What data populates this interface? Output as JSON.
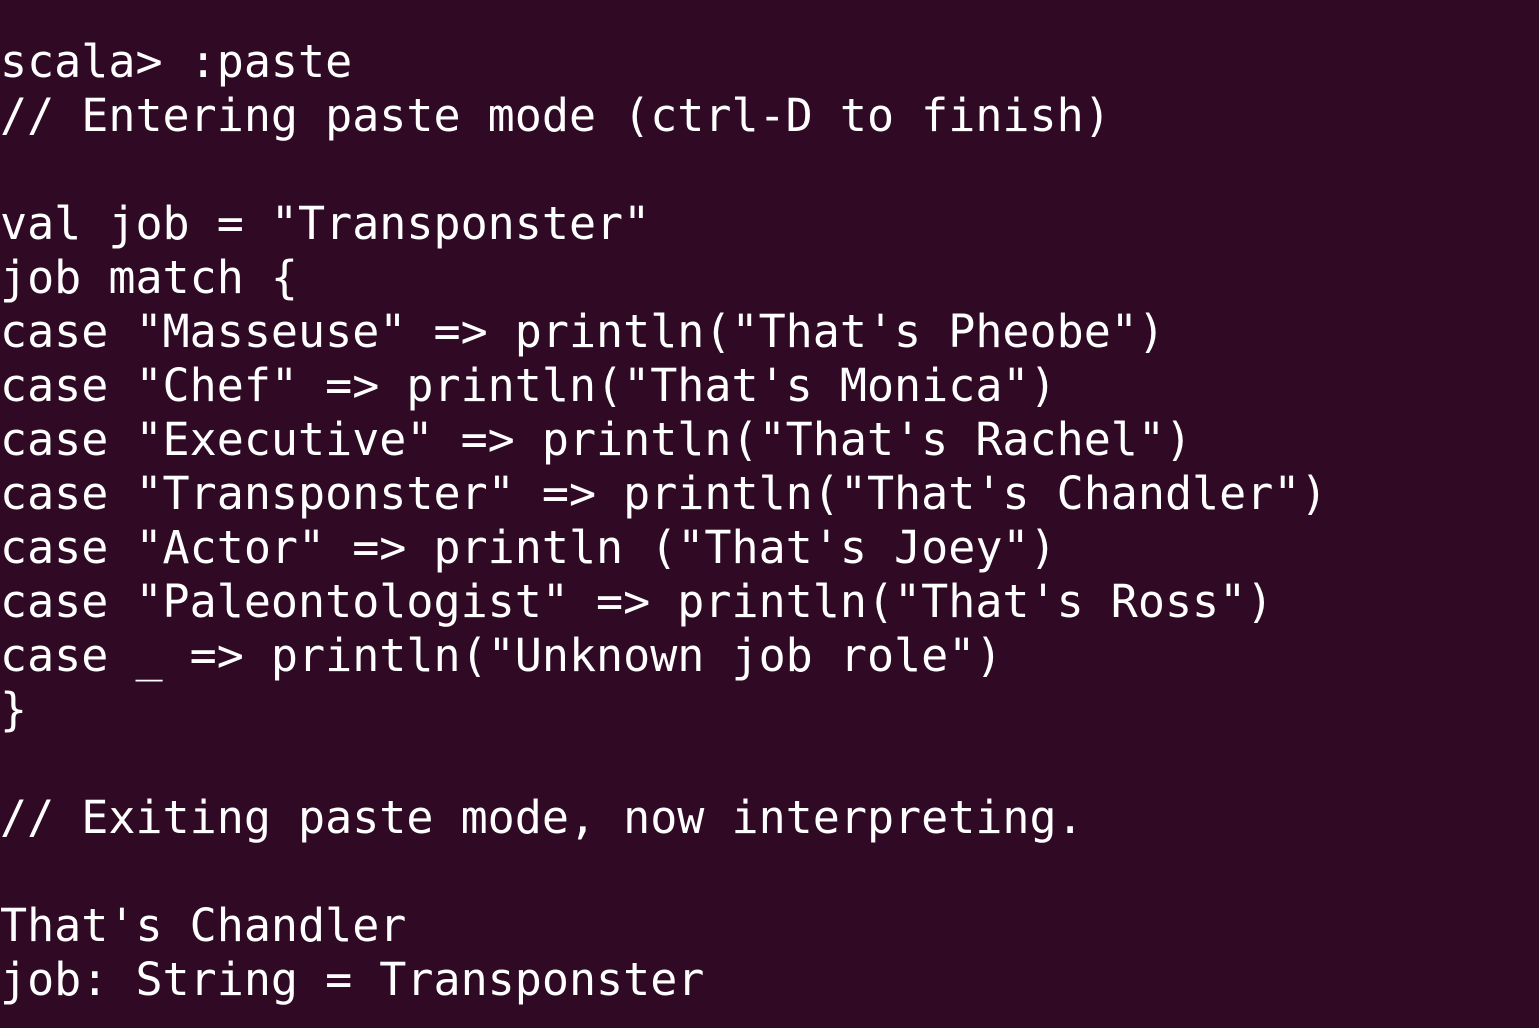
{
  "terminal": {
    "background": "#300a24",
    "foreground": "#ffffff",
    "lines": [
      "scala> :paste",
      "// Entering paste mode (ctrl-D to finish)",
      "",
      "val job = \"Transponster\"",
      "job match {",
      "case \"Masseuse\" => println(\"That's Pheobe\")",
      "case \"Chef\" => println(\"That's Monica\")",
      "case \"Executive\" => println(\"That's Rachel\")",
      "case \"Transponster\" => println(\"That's Chandler\")",
      "case \"Actor\" => println (\"That's Joey\")",
      "case \"Paleontologist\" => println(\"That's Ross\")",
      "case _ => println(\"Unknown job role\")",
      "}",
      "",
      "// Exiting paste mode, now interpreting.",
      "",
      "That's Chandler",
      "job: String = Transponster"
    ]
  }
}
